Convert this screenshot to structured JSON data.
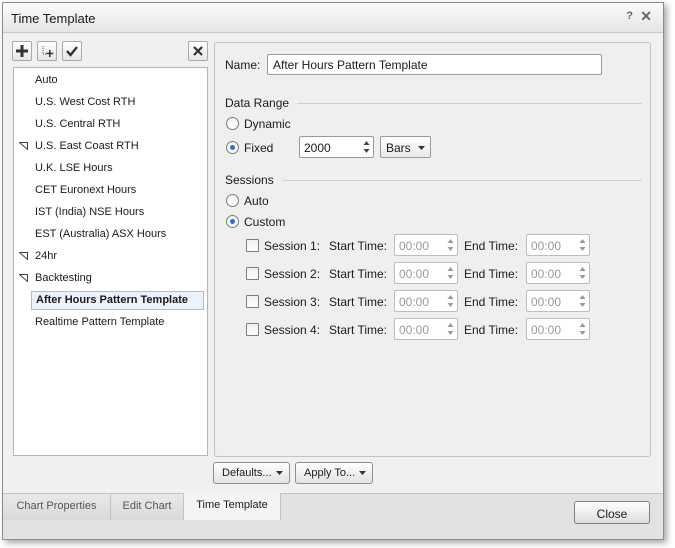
{
  "window": {
    "title": "Time Template",
    "help_label": "?",
    "close_label": "✕"
  },
  "tree": {
    "items": [
      {
        "label": "Auto",
        "expanded": null
      },
      {
        "label": "U.S. West Cost RTH",
        "expanded": null
      },
      {
        "label": "U.S. Central RTH",
        "expanded": null
      },
      {
        "label": "U.S. East Coast RTH",
        "expanded": true
      },
      {
        "label": "U.K. LSE Hours",
        "expanded": null
      },
      {
        "label": "CET Euronext Hours",
        "expanded": null
      },
      {
        "label": "IST (India) NSE Hours",
        "expanded": null
      },
      {
        "label": "EST (Australia) ASX Hours",
        "expanded": null
      },
      {
        "label": "24hr",
        "expanded": true
      },
      {
        "label": "Backtesting",
        "expanded": true
      },
      {
        "label": "After Hours Pattern Template",
        "expanded": null,
        "selected": true
      },
      {
        "label": "Realtime Pattern Template",
        "expanded": null
      }
    ]
  },
  "form": {
    "name_label": "Name:",
    "name_value": "After Hours Pattern Template",
    "data_range": {
      "heading": "Data Range",
      "dynamic_label": "Dynamic",
      "fixed_label": "Fixed",
      "selected": "Fixed",
      "fixed_value": "2000",
      "unit": "Bars"
    },
    "sessions": {
      "heading": "Sessions",
      "auto_label": "Auto",
      "custom_label": "Custom",
      "selected": "Custom",
      "start_label": "Start Time:",
      "end_label": "End Time:",
      "rows": [
        {
          "label": "Session 1:",
          "start": "00:00",
          "end": "00:00",
          "checked": false
        },
        {
          "label": "Session 2:",
          "start": "00:00",
          "end": "00:00",
          "checked": false
        },
        {
          "label": "Session 3:",
          "start": "00:00",
          "end": "00:00",
          "checked": false
        },
        {
          "label": "Session 4:",
          "start": "00:00",
          "end": "00:00",
          "checked": false
        }
      ]
    }
  },
  "buttons": {
    "defaults": "Defaults...",
    "apply_to": "Apply To...",
    "close": "Close"
  },
  "tabs": [
    "Chart Properties",
    "Edit Chart",
    "Time Template"
  ],
  "active_tab": "Time Template",
  "colors": {
    "accent": "#2a6fc9",
    "selection_bg": "#eaf3fb",
    "selection_border": "#9fc1e0"
  }
}
